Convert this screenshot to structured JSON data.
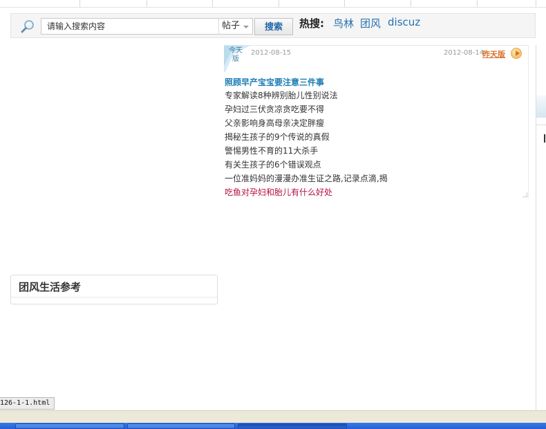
{
  "search": {
    "placeholder": "请输入搜索内容",
    "scope": "帖子",
    "button": "搜索",
    "hot_label": "热搜:",
    "hot_links": [
      "鸟林",
      "团风",
      "discuz"
    ]
  },
  "news": {
    "badge": "今天版",
    "date_today": "2012-08-15",
    "date_yesterday": "2012-08-14",
    "yesterday_label": "昨天版",
    "headline": "照顾早产宝宝要注意三件事",
    "items": [
      "专家解读8种辨别胎儿性别说法",
      "孕妇过三伏贪凉贪吃要不得",
      "父亲影响身高母亲决定胖瘦",
      "揭秘生孩子的9个传说的真假",
      "警惕男性不育的11大杀手",
      "有关生孩子的6个错误观点",
      "一位准妈妈的漫漫办准生证之路,记录点滴,揭",
      "吃鱼对孕妇和胎儿有什么好处"
    ],
    "highlight_color": "#b5113e",
    "headline_color": "#1d7db5"
  },
  "panel": {
    "title": "团风生活参考"
  },
  "status": {
    "url": "126-1-1.html"
  },
  "icons": {
    "search": "magnifier-icon",
    "next": "play-arrow-icon"
  }
}
